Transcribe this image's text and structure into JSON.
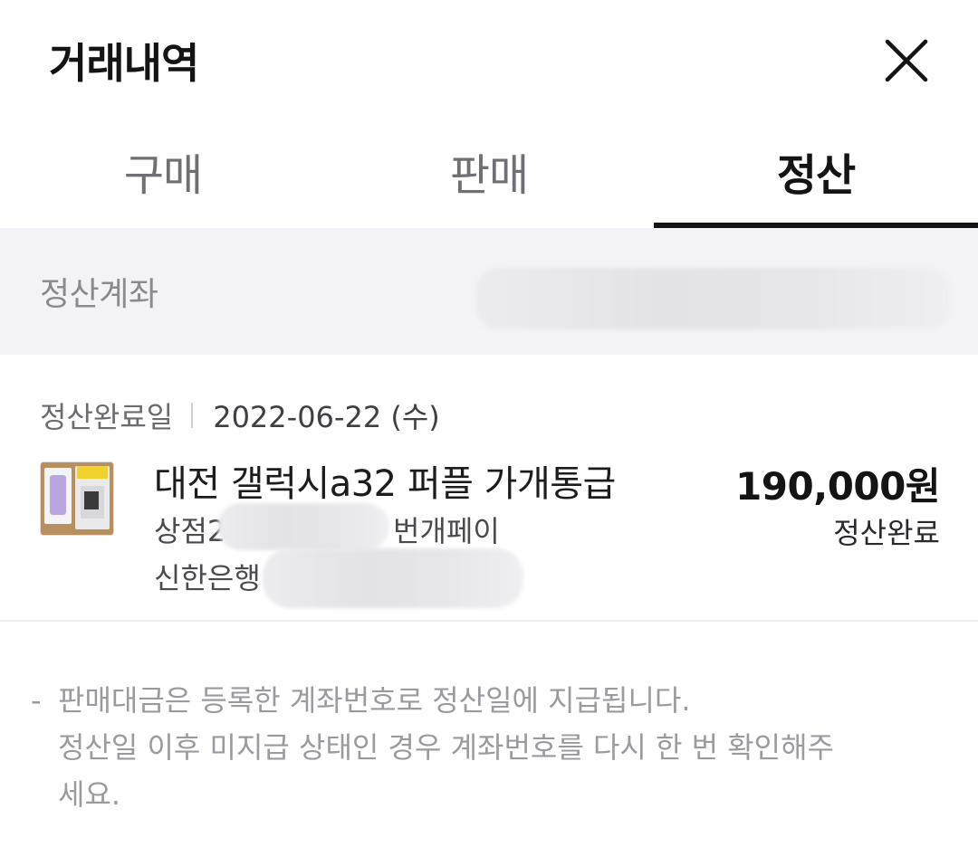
{
  "header": {
    "title": "거래내역"
  },
  "tabs": [
    {
      "label": "구매",
      "active": false
    },
    {
      "label": "판매",
      "active": false
    },
    {
      "label": "정산",
      "active": true
    }
  ],
  "account": {
    "label": "정산계좌"
  },
  "transaction": {
    "date_label": "정산완료일",
    "date": "2022-06-22 (수)",
    "item_title": "대전 갤럭시a32 퍼플 가개통급",
    "store_prefix": "상점2",
    "store_suffix": "번개페이",
    "bank": "신한은행",
    "price": "190,000원",
    "status": "정산완료"
  },
  "notice": {
    "dash": "-",
    "line1": "판매대금은 등록한 계좌번호로 정산일에 지급됩니다.",
    "line2": "정산일 이후 미지급 상태인 경우 계좌번호를 다시 한 번 확인해주",
    "line3": "세요."
  },
  "colors": {
    "accent": "#141414",
    "band": "#f3f3f7",
    "muted": "#9a9aa1"
  }
}
